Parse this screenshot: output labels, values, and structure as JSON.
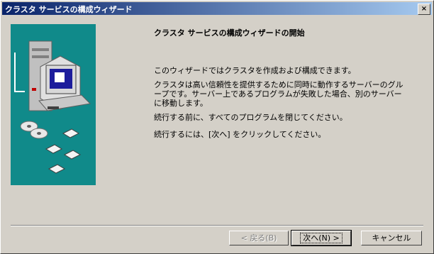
{
  "window": {
    "title": "クラスタ サービスの構成ウィザード",
    "close_glyph": "×"
  },
  "content": {
    "heading": "クラスタ サービスの構成ウィザードの開始",
    "paragraphs": [
      "このウィザードではクラスタを作成および構成できます。",
      "クラスタは高い信頼性を提供するために同時に動作するサーバーのグループです。サーバー上であるプログラムが失敗した場合、別のサーバーに移動します。",
      "続行する前に、すべてのプログラムを閉じてください。",
      "続行するには、[次へ] をクリックしてください。"
    ]
  },
  "buttons": {
    "back": "< 戻る(B)",
    "next": "次へ(N) >",
    "cancel": "キャンセル"
  },
  "colors": {
    "side_panel": "#108a8a",
    "titlebar_start": "#0a246a",
    "titlebar_end": "#a6caf0"
  }
}
